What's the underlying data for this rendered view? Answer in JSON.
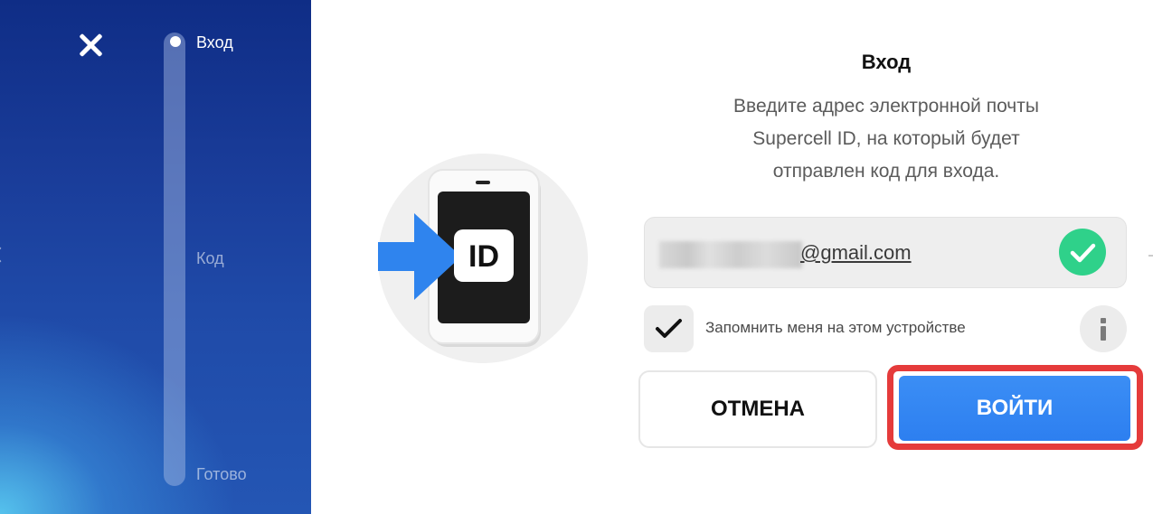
{
  "steps": [
    {
      "label": "Вход",
      "active": true
    },
    {
      "label": "Код",
      "active": false
    },
    {
      "label": "Готово",
      "active": false
    }
  ],
  "progress": {
    "current_step": 1,
    "total_steps": 3
  },
  "dialog": {
    "title": "Вход",
    "subtitle": "Введите адрес электронной почты\nSupercell ID, на который будет\nотправлен код для входа."
  },
  "email": {
    "visible_suffix": "@gmail.com",
    "valid": true
  },
  "remember": {
    "label": "Запомнить меня на этом устройстве",
    "checked": true
  },
  "buttons": {
    "cancel_label": "ОТМЕНА",
    "login_label": "ВОЙТИ"
  },
  "illustration": {
    "badge_text": "ID"
  },
  "colors": {
    "accent_blue": "#2d7ff0",
    "valid_green": "#2fd18a",
    "highlight_red": "#e53b3b",
    "panel_blue": "#1a3d9a"
  },
  "icons": {
    "close": "close-icon",
    "check": "checkmark-icon",
    "valid": "check-circle-icon",
    "info": "info-icon"
  }
}
